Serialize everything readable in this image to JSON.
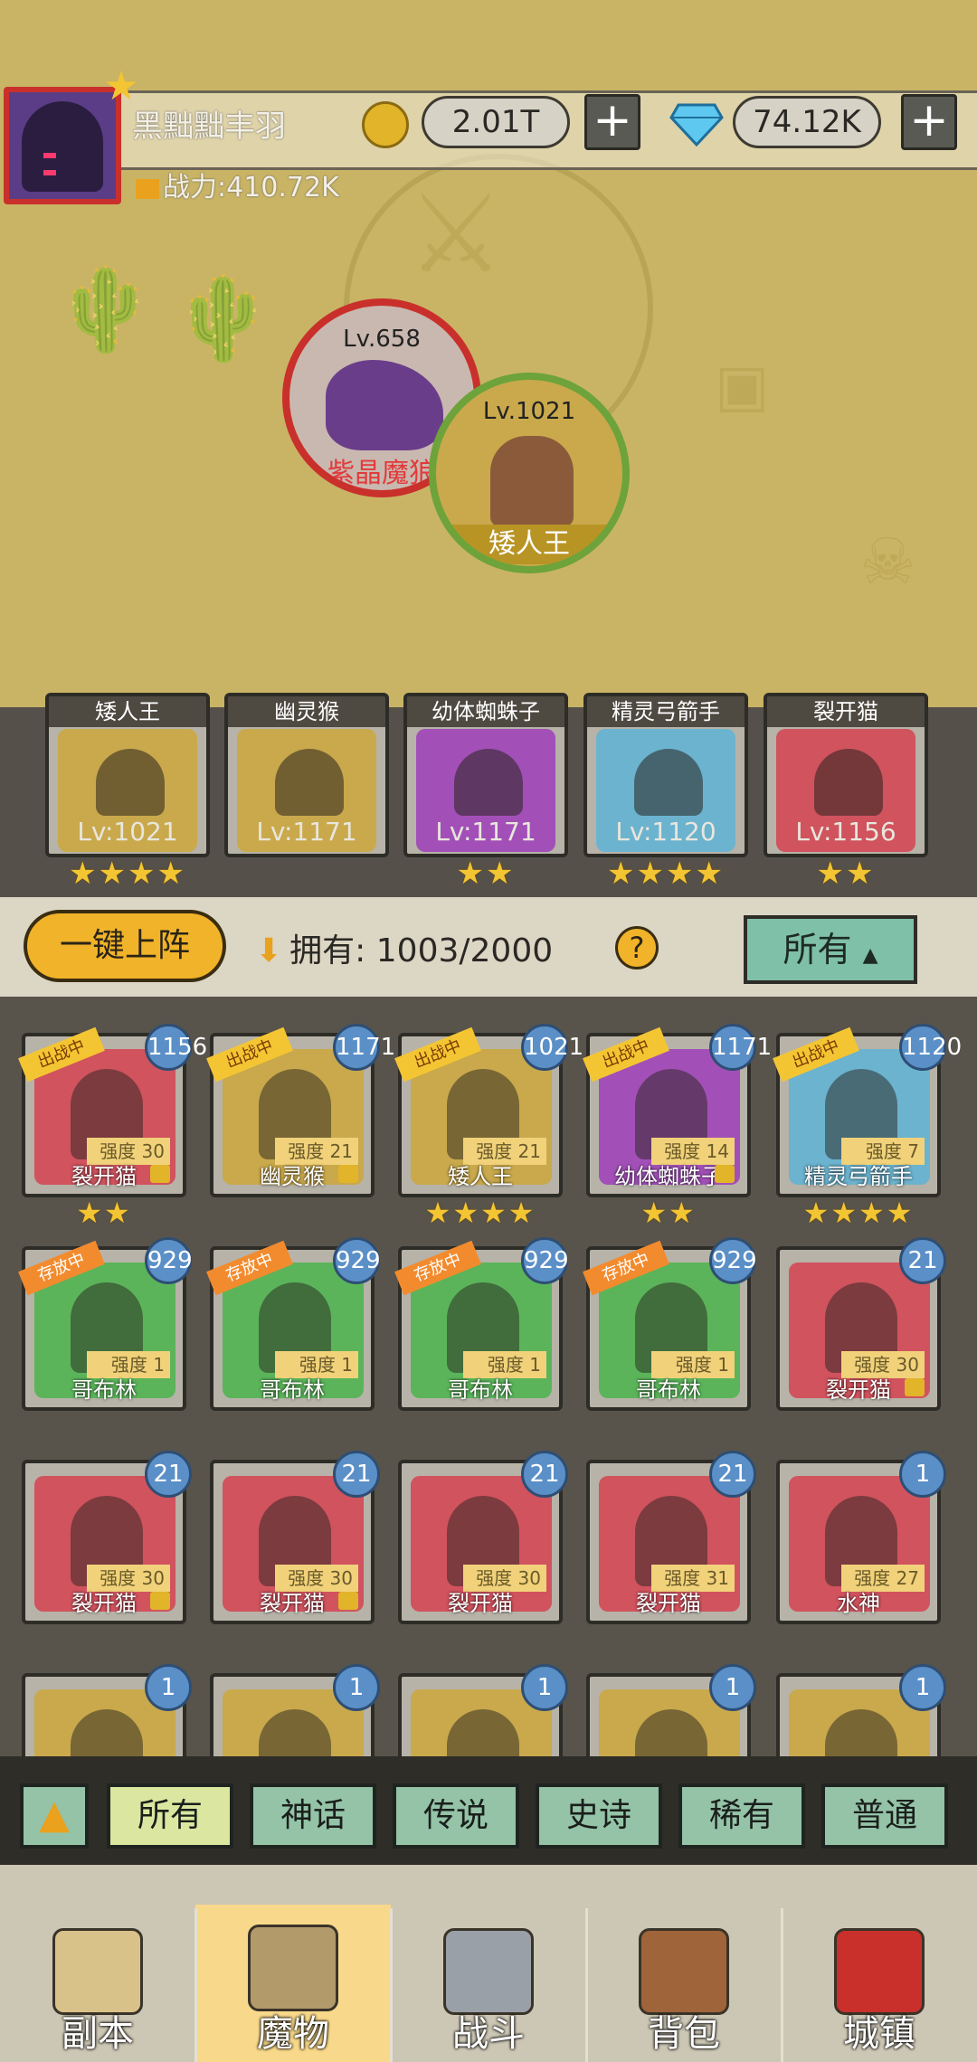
{
  "player": {
    "name": "黑黜黜丰羽",
    "power": "战力:410.72K",
    "gold": "2.01T",
    "diamonds": "74.12K"
  },
  "map": {
    "enemy_level": "Lv.658",
    "enemy_name": "紫晶魔狼",
    "boss_level": "Lv.1021",
    "boss_name": "矮人王"
  },
  "team": [
    {
      "name": "矮人王",
      "level": "Lv:1021",
      "stars": 4,
      "color": "#c9a94c"
    },
    {
      "name": "幽灵猴",
      "level": "Lv:1171",
      "stars": 0,
      "color": "#c9a94c"
    },
    {
      "name": "幼体蜘蛛子",
      "level": "Lv:1171",
      "stars": 2,
      "color": "#a250b8"
    },
    {
      "name": "精灵弓箭手",
      "level": "Lv:1120",
      "stars": 4,
      "color": "#6bb3cf"
    },
    {
      "name": "裂开猫",
      "level": "Lv:1156",
      "stars": 2,
      "color": "#d0535e"
    }
  ],
  "controls": {
    "deploy_button": "一键上阵",
    "owned_label": "拥有:",
    "owned_value": "1003/2000",
    "help": "?",
    "filter": "所有"
  },
  "cards": [
    {
      "name": "裂开猫",
      "level": "1156",
      "strength": "强度 30",
      "tag": "出战中",
      "stars": 2,
      "color": "#d0535e",
      "lock": true
    },
    {
      "name": "幽灵猴",
      "level": "1171",
      "strength": "强度 21",
      "tag": "出战中",
      "stars": 0,
      "color": "#c9a94c",
      "lock": true
    },
    {
      "name": "矮人王",
      "level": "1021",
      "strength": "强度 21",
      "tag": "出战中",
      "stars": 4,
      "color": "#c9a94c",
      "lock": false
    },
    {
      "name": "幼体蜘蛛子",
      "level": "1171",
      "strength": "强度 14",
      "tag": "出战中",
      "stars": 2,
      "color": "#a250b8",
      "lock": true
    },
    {
      "name": "精灵弓箭手",
      "level": "1120",
      "strength": "强度 7",
      "tag": "出战中",
      "stars": 4,
      "color": "#6bb3cf",
      "lock": false
    },
    {
      "name": "哥布林",
      "level": "929",
      "strength": "强度 1",
      "tag": "存放中",
      "stars": 0,
      "color": "#5bb45a",
      "lock": false
    },
    {
      "name": "哥布林",
      "level": "929",
      "strength": "强度 1",
      "tag": "存放中",
      "stars": 0,
      "color": "#5bb45a",
      "lock": false
    },
    {
      "name": "哥布林",
      "level": "929",
      "strength": "强度 1",
      "tag": "存放中",
      "stars": 0,
      "color": "#5bb45a",
      "lock": false
    },
    {
      "name": "哥布林",
      "level": "929",
      "strength": "强度 1",
      "tag": "存放中",
      "stars": 0,
      "color": "#5bb45a",
      "lock": false
    },
    {
      "name": "裂开猫",
      "level": "21",
      "strength": "强度 30",
      "tag": "",
      "stars": 0,
      "color": "#d0535e",
      "lock": true
    },
    {
      "name": "裂开猫",
      "level": "21",
      "strength": "强度 30",
      "tag": "",
      "stars": 0,
      "color": "#d0535e",
      "lock": true
    },
    {
      "name": "裂开猫",
      "level": "21",
      "strength": "强度 30",
      "tag": "",
      "stars": 0,
      "color": "#d0535e",
      "lock": true
    },
    {
      "name": "裂开猫",
      "level": "21",
      "strength": "强度 30",
      "tag": "",
      "stars": 0,
      "color": "#d0535e",
      "lock": false
    },
    {
      "name": "裂开猫",
      "level": "21",
      "strength": "强度 31",
      "tag": "",
      "stars": 0,
      "color": "#d0535e",
      "lock": false
    },
    {
      "name": "水神",
      "level": "1",
      "strength": "强度 27",
      "tag": "",
      "stars": 0,
      "color": "#d0535e",
      "lock": false
    },
    {
      "name": "",
      "level": "1",
      "strength": "",
      "tag": "",
      "stars": 0,
      "color": "#c9a94c",
      "lock": false
    },
    {
      "name": "",
      "level": "1",
      "strength": "",
      "tag": "",
      "stars": 0,
      "color": "#c9a94c",
      "lock": false
    },
    {
      "name": "",
      "level": "1",
      "strength": "",
      "tag": "",
      "stars": 0,
      "color": "#c9a94c",
      "lock": false
    },
    {
      "name": "",
      "level": "1",
      "strength": "",
      "tag": "",
      "stars": 0,
      "color": "#c9a94c",
      "lock": false
    },
    {
      "name": "",
      "level": "1",
      "strength": "",
      "tag": "",
      "stars": 0,
      "color": "#c9a94c",
      "lock": false
    }
  ],
  "rarity_filters": [
    "所有",
    "神话",
    "传说",
    "史诗",
    "稀有",
    "普通"
  ],
  "nav": [
    {
      "label": "副本",
      "icon": "map-scroll-icon"
    },
    {
      "label": "魔物",
      "icon": "monster-helmet-icon"
    },
    {
      "label": "战斗",
      "icon": "crossed-swords-icon"
    },
    {
      "label": "背包",
      "icon": "backpack-icon"
    },
    {
      "label": "城镇",
      "icon": "shop-icon"
    }
  ]
}
